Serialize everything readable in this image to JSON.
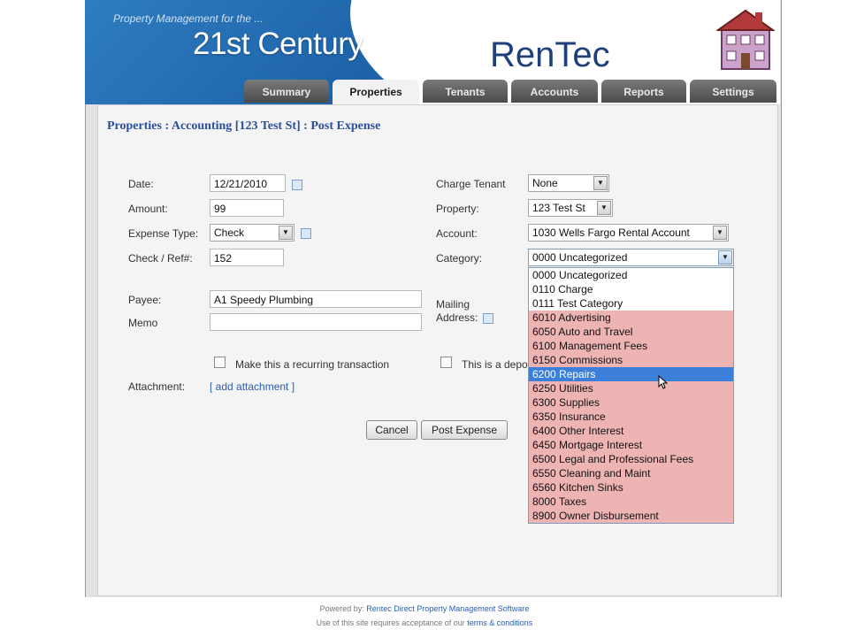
{
  "header": {
    "tagline": "Property Management for the ...",
    "title": "21st Century",
    "logo": "RenTec"
  },
  "tabs": [
    {
      "label": "Summary",
      "active": false
    },
    {
      "label": "Properties",
      "active": true
    },
    {
      "label": "Tenants",
      "active": false
    },
    {
      "label": "Accounts",
      "active": false
    },
    {
      "label": "Reports",
      "active": false
    },
    {
      "label": "Settings",
      "active": false
    }
  ],
  "breadcrumb": "Properties : Accounting [123 Test St] : Post Expense",
  "form": {
    "date_label": "Date:",
    "date_value": "12/21/2010",
    "amount_label": "Amount:",
    "amount_value": "99",
    "expense_type_label": "Expense Type:",
    "expense_type_value": "Check",
    "check_ref_label": "Check / Ref#:",
    "check_ref_value": "152",
    "payee_label": "Payee:",
    "payee_value": "A1 Speedy Plumbing",
    "memo_label": "Memo",
    "memo_value": "",
    "charge_tenant_label": "Charge Tenant",
    "charge_tenant_value": "None",
    "property_label": "Property:",
    "property_value": "123 Test St",
    "account_label": "Account:",
    "account_value": "1030 Wells Fargo Rental Account",
    "category_label": "Category:",
    "category_value": "0000 Uncategorized",
    "mailing_address_label_1": "Mailing",
    "mailing_address_label_2": "Address:",
    "recurring_label": "Make this a recurring transaction",
    "deposit_label": "This is a depo",
    "attachment_label": "Attachment:",
    "add_attachment_link": "[ add attachment ]",
    "cancel_button": "Cancel",
    "post_button": "Post Expense"
  },
  "category_options": [
    {
      "label": "0000 Uncategorized",
      "group": "plain"
    },
    {
      "label": "0110 Charge",
      "group": "plain"
    },
    {
      "label": "0111 Test Category",
      "group": "plain"
    },
    {
      "label": "6010 Advertising",
      "group": "pink"
    },
    {
      "label": "6050 Auto and Travel",
      "group": "pink"
    },
    {
      "label": "6100 Management Fees",
      "group": "pink"
    },
    {
      "label": "6150 Commissions",
      "group": "pink"
    },
    {
      "label": "6200 Repairs",
      "group": "highlight"
    },
    {
      "label": "6250 Utilities",
      "group": "pink"
    },
    {
      "label": "6300 Supplies",
      "group": "pink"
    },
    {
      "label": "6350 Insurance",
      "group": "pink"
    },
    {
      "label": "6400 Other Interest",
      "group": "pink"
    },
    {
      "label": "6450 Mortgage Interest",
      "group": "pink"
    },
    {
      "label": "6500 Legal and Professional Fees",
      "group": "pink"
    },
    {
      "label": "6550 Cleaning and Maint",
      "group": "pink"
    },
    {
      "label": "6560 Kitchen Sinks",
      "group": "pink"
    },
    {
      "label": "8000 Taxes",
      "group": "pink"
    },
    {
      "label": "8900 Owner Disbursement",
      "group": "pink"
    }
  ],
  "footer": {
    "powered_by": "Powered by:",
    "powered_link": "Rentec Direct Property Management Software",
    "terms_prefix": "Use of this site requires acceptance of our",
    "terms_link": "terms & conditions"
  },
  "colors": {
    "header_blue": "#1d62a8",
    "breadcrumb": "#2a4f9a",
    "highlight": "#3b7fd8",
    "pink_row": "#eeb4b4"
  }
}
